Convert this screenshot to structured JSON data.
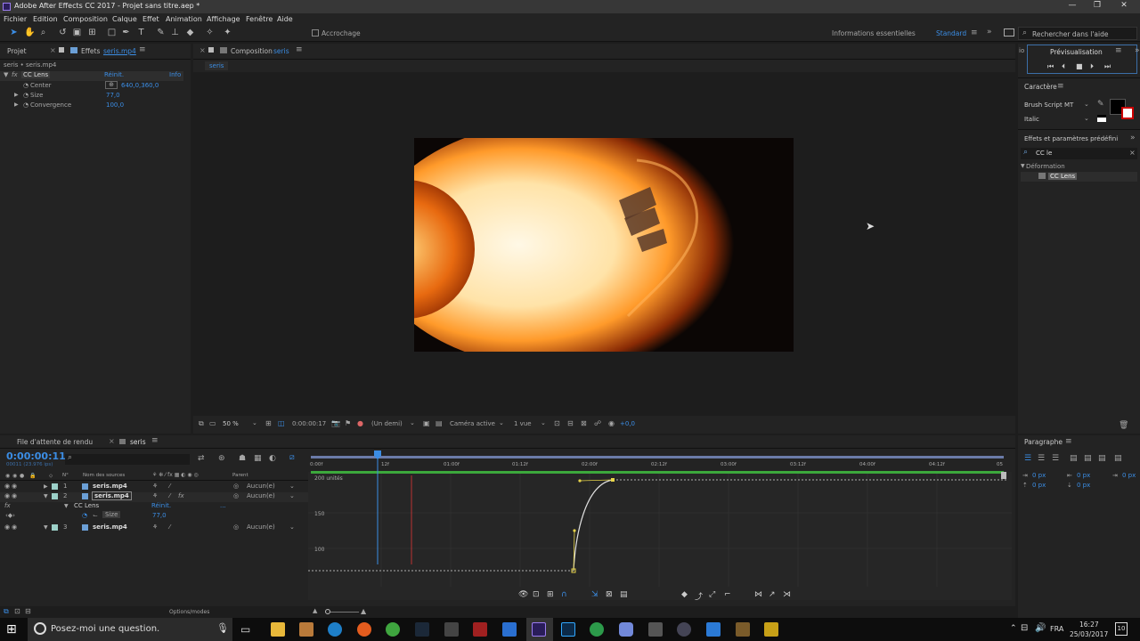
{
  "window": {
    "title": "Adobe After Effects CC 2017 - Projet sans titre.aep *"
  },
  "menu": [
    "Fichier",
    "Edition",
    "Composition",
    "Calque",
    "Effet",
    "Animation",
    "Affichage",
    "Fenêtre",
    "Aide"
  ],
  "toolbar": {
    "snap_label": "Accrochage",
    "workspace_info": "Informations essentielles",
    "workspace": "Standard",
    "search_placeholder": "Rechercher dans l'aide"
  },
  "left_panel": {
    "tab_project": "Projet",
    "tab_effects": "Effets",
    "tab_effects_file": "seris.mp4",
    "breadcrumb": "seris • seris.mp4",
    "effect_name": "CC Lens",
    "reset": "Réinit.",
    "info": "Info",
    "props": [
      {
        "name": "Center",
        "value": "640,0,360,0"
      },
      {
        "name": "Size",
        "value": "77,0"
      },
      {
        "name": "Convergence",
        "value": "100,0"
      }
    ]
  },
  "composition": {
    "tab_label": "Composition",
    "comp_name": "seris",
    "sub_tab": "seris",
    "footer": {
      "zoom": "50 %",
      "timecode": "0:00:00:17",
      "resolution": "(Un demi)",
      "camera": "Caméra active",
      "views": "1 vue",
      "exposure": "+0,0"
    }
  },
  "right_panel": {
    "io": "io",
    "preview_title": "Prévisualisation",
    "character_title": "Caractère",
    "font": "Brush Script MT",
    "style": "Italic",
    "effects_presets_title": "Effets et paramètres prédéfini",
    "search_value": "CC le",
    "category": "Déformation",
    "result": "CC Lens"
  },
  "timeline": {
    "tab_render": "File d'attente de rendu",
    "tab_comp": "seris",
    "timecode": "0:00:00:11",
    "frame_info": "00011 (23.976 ips)",
    "col_num": "N°",
    "col_source": "Nom des sources",
    "col_parent": "Parent",
    "layers": [
      {
        "num": "1",
        "name": "seris.mp4",
        "parent": "Aucun(e)"
      },
      {
        "num": "2",
        "name": "seris.mp4",
        "parent": "Aucun(e)"
      },
      {
        "num": "3",
        "name": "seris.mp4",
        "parent": "Aucun(e)"
      }
    ],
    "sub_effect": "CC Lens",
    "sub_reset": "Réinit.",
    "sub_reset_more": "...",
    "sub_prop": "Size",
    "sub_value": "77,0",
    "ruler": [
      "0:00f",
      "12f",
      "01:00f",
      "01:12f",
      "02:00f",
      "02:12f",
      "03:00f",
      "03:12f",
      "04:00f",
      "04:12f",
      "05"
    ],
    "graph_labels": [
      "200 unités",
      "150",
      "100"
    ],
    "footer_options": "Options/modes"
  },
  "paragraph": {
    "title": "Paragraphe",
    "values": [
      "0 px",
      "0 px",
      "0 px",
      "0 px",
      "0 px"
    ]
  },
  "taskbar": {
    "search": "Posez-moi une question.",
    "lang": "FRA",
    "time": "16:27",
    "date": "25/03/2017",
    "notif": "10"
  }
}
